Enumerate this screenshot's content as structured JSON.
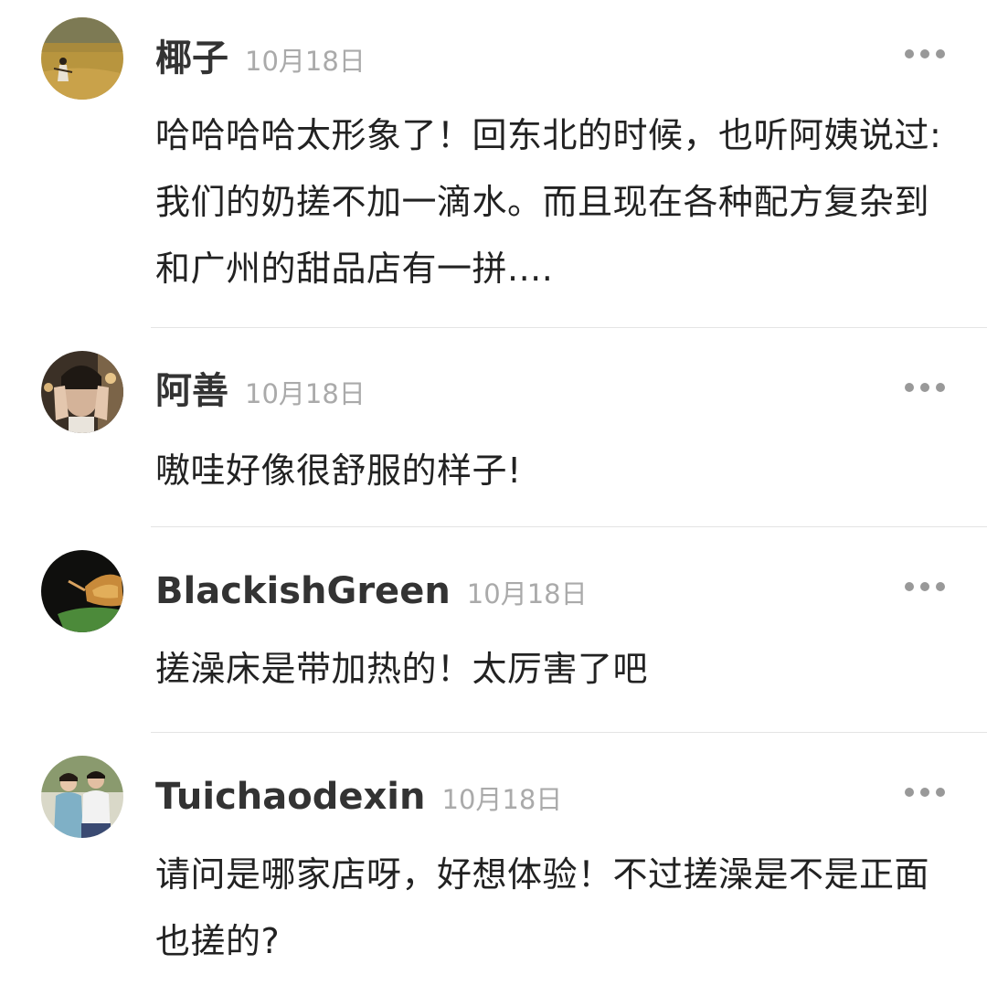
{
  "comments": [
    {
      "username": "椰子",
      "date": "10月18日",
      "text": "哈哈哈哈太形象了！回东北的时候，也听阿姨说过:我们的奶搓不加一滴水。而且现在各种配方复杂到和广州的甜品店有一拼....",
      "avatar": "avatar-field-person"
    },
    {
      "username": "阿善",
      "date": "10月18日",
      "text": "嗷哇好像很舒服的样子!",
      "avatar": "avatar-person-hands-face"
    },
    {
      "username": "BlackishGreen",
      "date": "10月18日",
      "text": "搓澡床是带加热的！太厉害了吧",
      "avatar": "avatar-dark-food"
    },
    {
      "username": "Tuichaodexin",
      "date": "10月18日",
      "text": "请问是哪家店呀，好想体验！不过搓澡是不是正面也搓的?",
      "avatar": "avatar-couple-photo"
    }
  ],
  "colors": {
    "username": "#333333",
    "timestamp": "#aaaaaa",
    "text": "#222222",
    "divider": "#e4e4e4",
    "more_dots": "#999999"
  },
  "icons": {
    "more": "more-horizontal-icon"
  }
}
